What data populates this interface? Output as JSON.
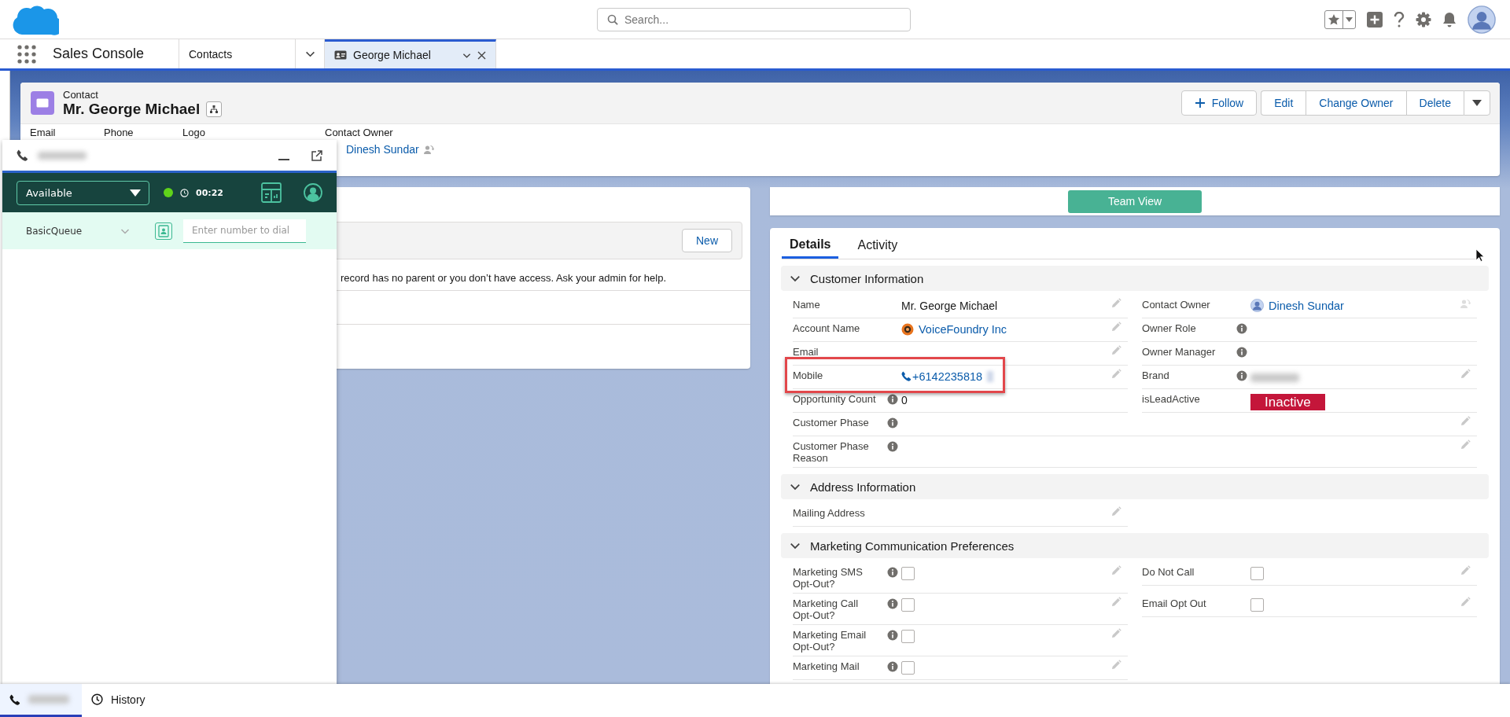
{
  "app": {
    "name": "Sales Console"
  },
  "global_search": {
    "placeholder": "Search..."
  },
  "nav_tabs": [
    {
      "label": "Contacts",
      "kind": "object",
      "selected": false
    },
    {
      "label": "George Michael",
      "kind": "record",
      "selected": true
    }
  ],
  "record_header": {
    "object": "Contact",
    "title": "Mr. George Michael",
    "follow": "Follow",
    "actions": [
      "Edit",
      "Change Owner",
      "Delete"
    ],
    "highlights": [
      {
        "label": "Email"
      },
      {
        "label": "Phone"
      },
      {
        "label": "Logo"
      },
      {
        "label": "Contact Owner",
        "value": "Dinesh Sundar"
      }
    ]
  },
  "softphone": {
    "header": {
      "kind": "redacted"
    },
    "status": "Available",
    "online": true,
    "timer": "00:22",
    "queue": "BasicQueue",
    "dial_placeholder": "Enter number to dial"
  },
  "related_panel": {
    "button": "New",
    "message": "record has no parent or you don’t have access. Ask your admin for help."
  },
  "team_view_button": "Team View",
  "detail_tabs": [
    {
      "label": "Details",
      "selected": true
    },
    {
      "label": "Activity",
      "selected": false
    }
  ],
  "sections": [
    {
      "title": "Customer Information",
      "expanded": true,
      "rows": [
        {
          "wide": false,
          "fields": [
            {
              "label": "Name",
              "kind": "text",
              "value": "Mr. George Michael",
              "info": false,
              "editable": true,
              "highlighted": false
            },
            {
              "label": "Contact Owner",
              "kind": "user",
              "value": "Dinesh Sundar",
              "info": false,
              "editable": false,
              "highlighted": false
            }
          ]
        },
        {
          "wide": false,
          "fields": [
            {
              "label": "Account Name",
              "kind": "link",
              "value": "VoiceFoundry Inc",
              "info": false,
              "editable": true,
              "highlighted": false
            },
            {
              "label": "Owner Role",
              "kind": "empty",
              "info": true,
              "editable": false,
              "highlighted": false
            }
          ]
        },
        {
          "wide": false,
          "fields": [
            {
              "label": "Email",
              "kind": "empty",
              "info": false,
              "editable": true,
              "highlighted": false
            },
            {
              "label": "Owner Manager",
              "kind": "empty",
              "info": true,
              "editable": false,
              "highlighted": false
            }
          ]
        },
        {
          "wide": false,
          "fields": [
            {
              "label": "Mobile",
              "kind": "phone",
              "value": "+6142235818",
              "info": false,
              "editable": true,
              "highlighted": true
            },
            {
              "label": "Brand",
              "kind": "redacted",
              "info": true,
              "editable": true,
              "highlighted": false
            }
          ]
        },
        {
          "wide": false,
          "fields": [
            {
              "label": "Opportunity Count",
              "kind": "text",
              "value": "0",
              "info": true,
              "editable": false,
              "highlighted": false
            },
            {
              "label": "isLeadActive",
              "kind": "badge",
              "value": "Inactive",
              "info": false,
              "editable": false,
              "highlighted": false
            }
          ]
        },
        {
          "wide": true,
          "fields": [
            {
              "label": "Customer Phase",
              "kind": "empty",
              "info": true,
              "editable": true,
              "highlighted": false
            }
          ]
        },
        {
          "wide": true,
          "fields": [
            {
              "label": "Customer Phase Reason",
              "kind": "empty",
              "info": true,
              "editable": true,
              "highlighted": false
            }
          ]
        }
      ]
    },
    {
      "title": "Address Information",
      "expanded": true,
      "rows": [
        {
          "wide": false,
          "fields": [
            {
              "label": "Mailing Address",
              "kind": "empty",
              "info": false,
              "editable": true,
              "highlighted": false
            }
          ]
        }
      ]
    },
    {
      "title": "Marketing Communication Preferences",
      "expanded": true,
      "rows": [
        {
          "wide": false,
          "fields": [
            {
              "label": "Marketing SMS Opt-Out?",
              "kind": "checkbox",
              "checked": false,
              "info": true,
              "editable": true,
              "highlighted": false
            },
            {
              "label": "Do Not Call",
              "kind": "checkbox",
              "checked": false,
              "info": false,
              "editable": true,
              "highlighted": false
            }
          ]
        },
        {
          "wide": false,
          "fields": [
            {
              "label": "Marketing Call Opt-Out?",
              "kind": "checkbox",
              "checked": false,
              "info": true,
              "editable": true,
              "highlighted": false
            },
            {
              "label": "Email Opt Out",
              "kind": "checkbox",
              "checked": false,
              "info": false,
              "editable": true,
              "highlighted": false
            }
          ]
        },
        {
          "wide": false,
          "fields": [
            {
              "label": "Marketing Email Opt-Out?",
              "kind": "checkbox",
              "checked": false,
              "info": true,
              "editable": true,
              "highlighted": false
            }
          ]
        },
        {
          "wide": false,
          "fields": [
            {
              "label": "Marketing Mail",
              "kind": "checkbox",
              "checked": false,
              "info": true,
              "editable": true,
              "highlighted": false
            }
          ]
        }
      ]
    }
  ],
  "utility_bar": [
    {
      "kind": "phone_session",
      "selected": true
    },
    {
      "kind": "history",
      "label": "History",
      "selected": false
    }
  ]
}
